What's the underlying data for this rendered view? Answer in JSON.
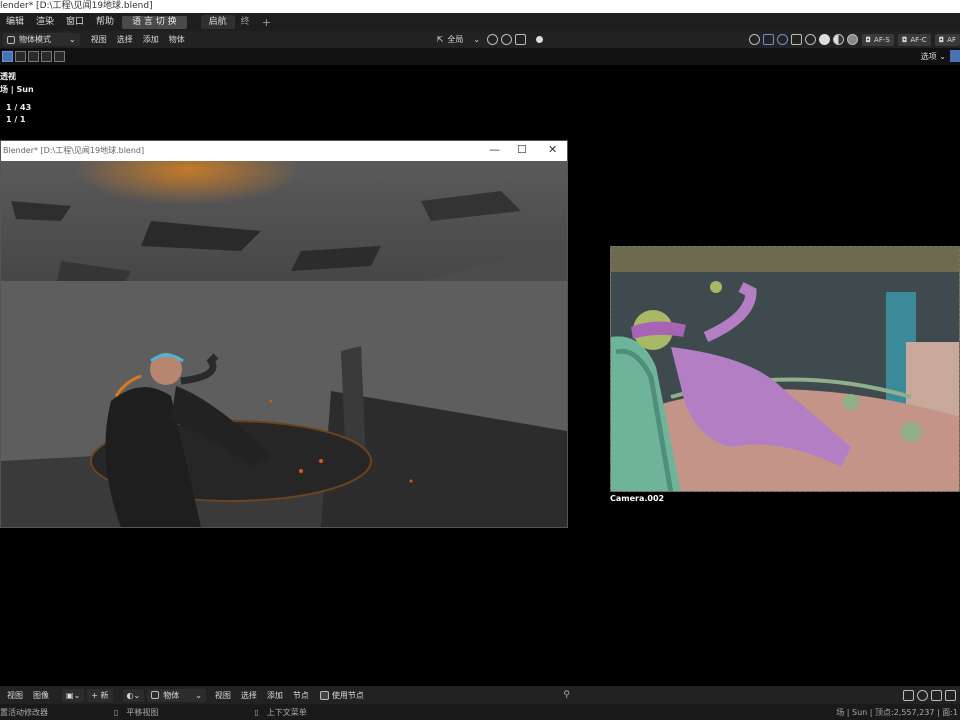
{
  "window": {
    "title": "lender* [D:\\工程\\见闻19地球.blend]"
  },
  "menu": {
    "items": [
      "编辑",
      "渲染",
      "窗口",
      "帮助"
    ],
    "lang_button": "语 言 切 换",
    "tabs": [
      "启航",
      "终"
    ],
    "add_tab": "+"
  },
  "header": {
    "mode": "物体模式",
    "menus": [
      "视图",
      "选择",
      "添加",
      "物体"
    ],
    "orientation": "全局",
    "af_buttons": [
      "AF-S",
      "AF-C",
      "AF"
    ]
  },
  "toolbar": {
    "options_label": "选项"
  },
  "overlay": {
    "view_name": "透视",
    "collection": "场 | Sun",
    "objects": "1 / 43",
    "count2": "1 / 1"
  },
  "render_window": {
    "title": "Blender* [D:\\工程\\见闻19地球.blend]",
    "minimize": "—",
    "maximize": "☐",
    "close": "✕"
  },
  "camera": {
    "label": "Camera.002"
  },
  "bottom": {
    "menus_left": [
      "视图",
      "图像"
    ],
    "new_label": "新",
    "object_label": "物体",
    "menus_mid": [
      "视图",
      "选择",
      "添加",
      "节点"
    ],
    "use_nodes": "使用节点"
  },
  "status": {
    "left": "置活动修改器",
    "pan": "平移视图",
    "context": "上下文菜单",
    "right": "场 | Sun | 顶点:2,557,237 | 面:1"
  },
  "colors": {
    "accent": "#4772b3",
    "background": "#000000"
  }
}
